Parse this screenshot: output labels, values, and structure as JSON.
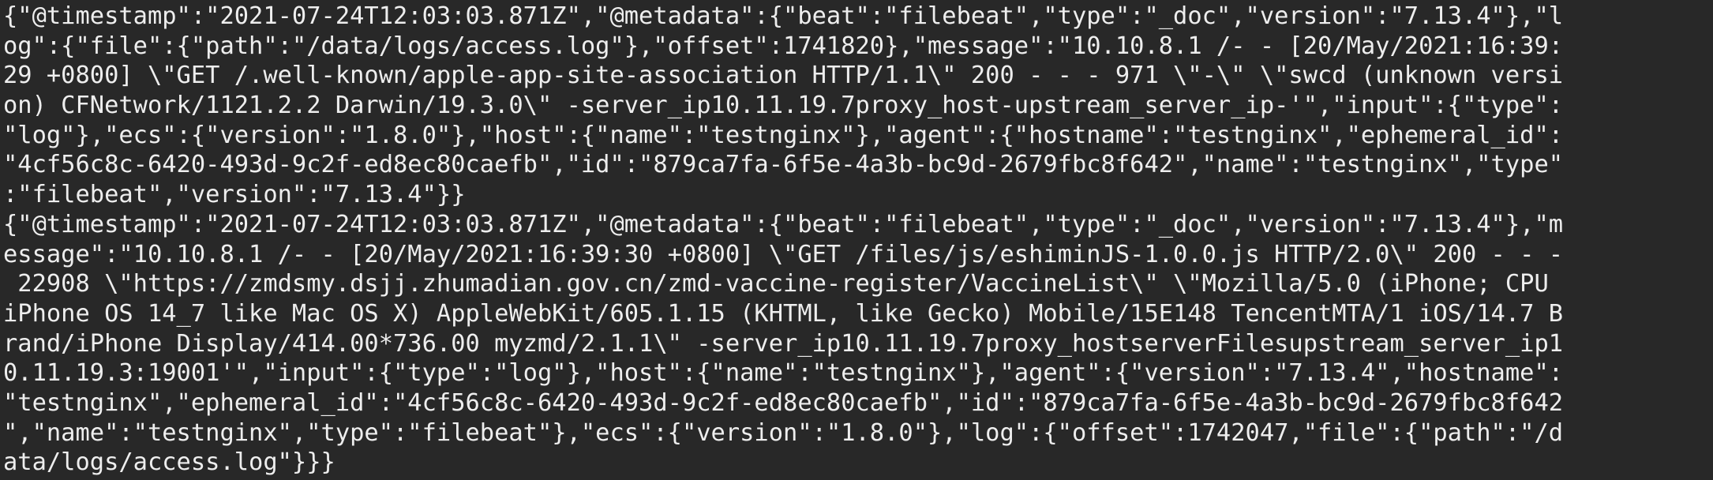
{
  "terminal": {
    "lines": [
      "{\"@timestamp\":\"2021-07-24T12:03:03.871Z\",\"@metadata\":{\"beat\":\"filebeat\",\"type\":\"_doc\",\"version\":\"7.13.4\"},\"l",
      "og\":{\"file\":{\"path\":\"/data/logs/access.log\"},\"offset\":1741820},\"message\":\"10.10.8.1 /- - [20/May/2021:16:39:",
      "29 +0800] \\\"GET /.well-known/apple-app-site-association HTTP/1.1\\\" 200 - - - 971 \\\"-\\\" \\\"swcd (unknown versi",
      "on) CFNetwork/1121.2.2 Darwin/19.3.0\\\" -server_ip10.11.19.7proxy_host-upstream_server_ip-'\",\"input\":{\"type\":",
      "\"log\"},\"ecs\":{\"version\":\"1.8.0\"},\"host\":{\"name\":\"testnginx\"},\"agent\":{\"hostname\":\"testnginx\",\"ephemeral_id\":",
      "\"4cf56c8c-6420-493d-9c2f-ed8ec80caefb\",\"id\":\"879ca7fa-6f5e-4a3b-bc9d-2679fbc8f642\",\"name\":\"testnginx\",\"type\"",
      ":\"filebeat\",\"version\":\"7.13.4\"}}",
      "{\"@timestamp\":\"2021-07-24T12:03:03.871Z\",\"@metadata\":{\"beat\":\"filebeat\",\"type\":\"_doc\",\"version\":\"7.13.4\"},\"m",
      "essage\":\"10.10.8.1 /- - [20/May/2021:16:39:30 +0800] \\\"GET /files/js/eshiminJS-1.0.0.js HTTP/2.0\\\" 200 - - -",
      " 22908 \\\"https://zmdsmy.dsjj.zhumadian.gov.cn/zmd-vaccine-register/VaccineList\\\" \\\"Mozilla/5.0 (iPhone; CPU",
      "iPhone OS 14_7 like Mac OS X) AppleWebKit/605.1.15 (KHTML, like Gecko) Mobile/15E148 TencentMTA/1 iOS/14.7 B",
      "rand/iPhone Display/414.00*736.00 myzmd/2.1.1\\\" -server_ip10.11.19.7proxy_hostserverFilesupstream_server_ip1",
      "0.11.19.3:19001'\",\"input\":{\"type\":\"log\"},\"host\":{\"name\":\"testnginx\"},\"agent\":{\"version\":\"7.13.4\",\"hostname\":",
      "\"testnginx\",\"ephemeral_id\":\"4cf56c8c-6420-493d-9c2f-ed8ec80caefb\",\"id\":\"879ca7fa-6f5e-4a3b-bc9d-2679fbc8f642",
      "\",\"name\":\"testnginx\",\"type\":\"filebeat\"},\"ecs\":{\"version\":\"1.8.0\"},\"log\":{\"offset\":1742047,\"file\":{\"path\":\"/d",
      "ata/logs/access.log\"}}}"
    ]
  }
}
